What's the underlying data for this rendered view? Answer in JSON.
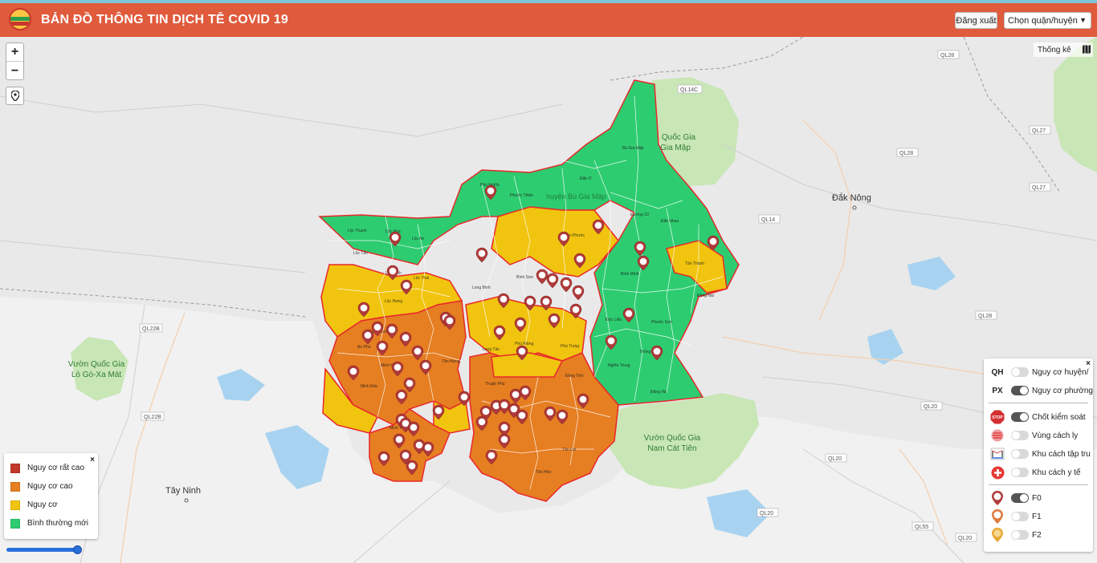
{
  "header": {
    "title": "BẢN ĐỒ THÔNG TIN DỊCH TỄ COVID 19",
    "logout_label": "Đăng xuất",
    "district_select_value": "Chọn quận/huyện"
  },
  "controls": {
    "zoom_in": "+",
    "zoom_out": "−",
    "stats_label": "Thống kê"
  },
  "legend": {
    "close": "×",
    "items": [
      {
        "label": "Nguy cơ rất cao",
        "color": "#c0392b"
      },
      {
        "label": "Nguy cơ cao",
        "color": "#e67e22"
      },
      {
        "label": "Nguy cơ",
        "color": "#f1c40f"
      },
      {
        "label": "Bình thường mới",
        "color": "#2ecc71"
      }
    ]
  },
  "layers": {
    "close": "×",
    "qh_code": "QH",
    "qh_label": "Nguy cơ huyện/",
    "px_code": "PX",
    "px_label": "Nguy cơ phường",
    "checkpoint_label": "Chốt kiểm soát",
    "isolation_zone_label": "Vùng cách ly",
    "camp_label": "Khu cách tập tru",
    "medical_label": "Khu cách y tế",
    "f0_label": "F0",
    "f1_label": "F1",
    "f2_label": "F2",
    "stop_text": "STOP"
  },
  "map_labels": {
    "tay_ninh": "Tây Ninh",
    "dak_nong": "Đắk Nông",
    "bu_gia_map_park": [
      "Quốc Gia",
      "Gia Mập"
    ],
    "lo_go_park": [
      "Vườn Quốc Gia",
      "Lò Gò-Xa Mát"
    ],
    "cat_tien_park": [
      "Vườn Quốc Gia",
      "Nam Cát Tiên"
    ],
    "bu_gia_map_district": "huyện Bù Gia Mập",
    "roads": [
      "QL28",
      "QL14C",
      "QL27",
      "QL28",
      "QL27",
      "QL14",
      "QL22B",
      "QL22B",
      "QL28",
      "QL20",
      "QL20",
      "QL20",
      "QL55",
      "QL20"
    ],
    "communes": [
      "Phú Nghĩa",
      "Phước Thiện",
      "Đăk Ơ",
      "Bù Gia Mập",
      "Đường 10",
      "Đăk Nhau",
      "Lộc Thạnh",
      "Lộc Hòa",
      "Lộc An",
      "Lộc Tấn",
      "Lộc Hưng",
      "Lộc Thái",
      "Lộc Ninh",
      "An Phú",
      "Minh Hưng",
      "Minh Đức",
      "Tân Hưng",
      "Thanh Lương",
      "Thuận Phú",
      "Đồng Tiến",
      "Tân Lợi",
      "Tân Hòa",
      "Bình Minh",
      "Đức Liễu",
      "Thống Nhất",
      "Đăng Hà",
      "Nghĩa Trung",
      "Phước Sơn",
      "Đồng Nai",
      "Tân Thành",
      "Minh Thành",
      "Phú Riềng",
      "Long Bình",
      "Long Tân",
      "Bình Sơn",
      "Phú Trung",
      "Tân Phước"
    ]
  }
}
